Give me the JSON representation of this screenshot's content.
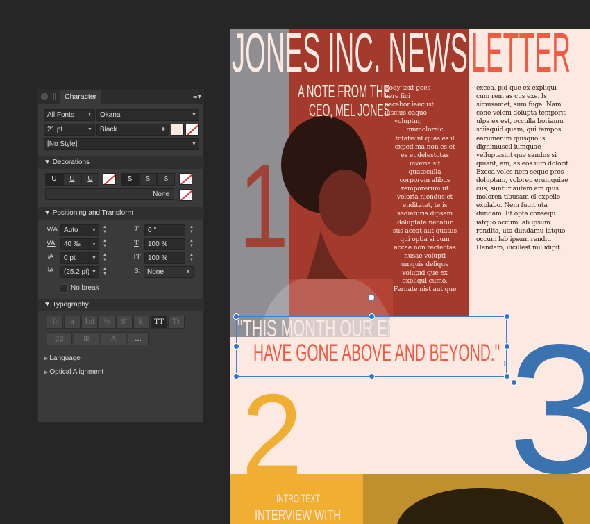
{
  "panel": {
    "tab_label": "Character",
    "font_collection": "All Fonts",
    "font_family": "Okana",
    "font_size": "21 pt",
    "font_style": "Black",
    "paragraph_style": "[No Style]",
    "fill_color": "#fce9e1",
    "sections": {
      "decorations": "Decorations",
      "positioning": "Positioning and Transform",
      "typography": "Typography",
      "language": "Language",
      "optical": "Optical Alignment"
    },
    "decorations": {
      "underline_buttons": [
        "U",
        "U",
        "U"
      ],
      "strike_buttons": [
        "S",
        "S",
        "S"
      ],
      "line_style": "None"
    },
    "positioning": {
      "kerning": "Auto",
      "tracking": "40 ‰",
      "baseline": "0 pt",
      "leading": "(25.2 pt)",
      "shear": "0 °",
      "vertical_scale": "100 %",
      "horizontal_scale": "100 %",
      "script": "None",
      "no_break_label": "No break"
    },
    "typography_buttons": [
      "fi",
      "a",
      "1st",
      "½",
      "S'",
      "S,",
      "TT",
      "Tт"
    ],
    "typography_buttons2": [
      "gg",
      "⊞",
      "A",
      "..."
    ]
  },
  "document": {
    "title_part1": "JONES INC. NEWS",
    "title_part2": "LETTER",
    "note_line1": "A NOTE FROM THE",
    "note_line2": "CEO, MEL JONES",
    "number1": "1",
    "number2": "2",
    "number3": "3",
    "col1_lines": [
      "Body text goes",
      "here fici",
      "necabor iaecust",
      "iuscius eaquo",
      "voluptur,",
      "ommoloreic",
      "totatisint quas es il",
      "exped ma non es et",
      "es et delestotas",
      "inveria sit",
      "quateculla",
      "corporem alibus",
      "remporerum ut",
      "voloria niendus et",
      "enditatet, te is",
      "sediaturia dipsam",
      "doluptate necatur",
      "sus aceat aut quatus",
      "qui optia si cum",
      "accae non rectectas",
      "nusae volupti",
      "umquis delique",
      "volupid que ex",
      "expliqui cumo.",
      "Fernate nist aut que"
    ],
    "col2_lines": [
      "excea, pid que ex expliqui",
      "cum rem as cus exe. Is",
      "simusamet, sum fuga. Nam,",
      "cone veleni dolupta temporit",
      "ulpa ex est, occulla boriamu",
      "sciisquid quam, qui tempos",
      "earumenim quisquo is",
      "dignimuscil iumquae",
      "velluptasint que sandus si",
      "quiant, am, as eos ium dolorit.",
      "Excea voles nem seque pres",
      "doluptam, volorep erumquiae",
      "cus, suntur autem am quis",
      "moloren tibusam el expello",
      "explabo. Nem fugit uta",
      "dundam. Et opta consequ",
      "iatquo occum lab ipsum",
      "rendita, uta dundamu iatquo",
      "occum lab ipsum rendit.",
      "Hendam, ilicillest mil idipit."
    ],
    "quote_line1": "\"THIS MONTH OUR EMPLOYEES",
    "quote_line2": "HAVE GONE ABOVE AND BEYOND.\"",
    "intro_text": "INTRO TEXT",
    "interview_text": "INTERVIEW WITH",
    "colors": {
      "red": "#a33a2c",
      "coral": "#ee5a43",
      "peach": "#fce9e1",
      "blue": "#3a73b0",
      "yellow": "#f0ae33",
      "gray": "#8f8f93"
    }
  }
}
